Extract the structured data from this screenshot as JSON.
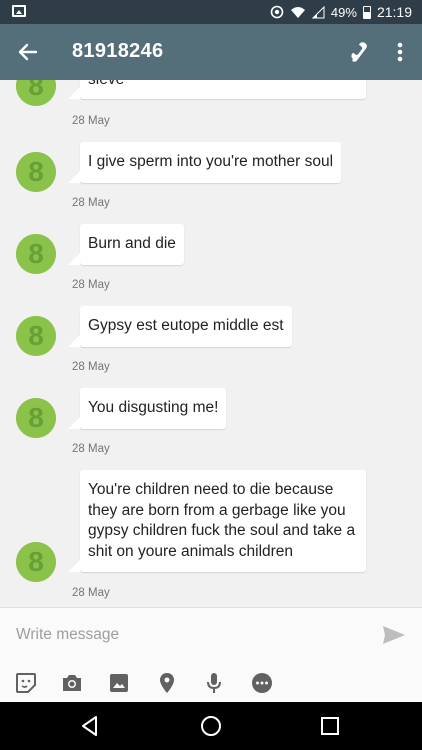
{
  "status_bar": {
    "battery": "49%",
    "time": "21:19"
  },
  "app_bar": {
    "title": "81918246"
  },
  "messages": [
    {
      "text": "sieve",
      "date": "28 May"
    },
    {
      "text": "I give sperm into you're mother soul",
      "date": "28 May"
    },
    {
      "text": "Burn and die",
      "date": "28 May"
    },
    {
      "text": "Gypsy est eutope middle est",
      "date": "28 May"
    },
    {
      "text": "You disgusting me!",
      "date": "28 May"
    },
    {
      "text": "You're children need to die because they are born from a gerbage like you gypsy children fuck the soul and take a shit on youre animals children",
      "date": "28 May"
    }
  ],
  "composer": {
    "placeholder": "Write message"
  },
  "colors": {
    "app_bar": "#546e7a",
    "status_bar": "#2e3d47",
    "avatar": "#8bc34a",
    "background": "#f1f1f1"
  },
  "icons": [
    "back-arrow-icon",
    "phone-icon",
    "more-vert-icon",
    "sticker-icon",
    "camera-icon",
    "image-icon",
    "location-icon",
    "microphone-icon",
    "more-horiz-icon",
    "send-icon",
    "nav-back-icon",
    "nav-home-icon",
    "nav-recents-icon"
  ]
}
